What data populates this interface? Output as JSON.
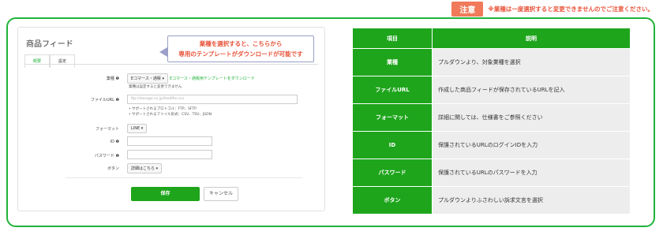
{
  "notice": {
    "badge": "注意",
    "text": "※業種は一度選択すると変更できませんのでご注意ください。"
  },
  "form": {
    "title": "商品フィード",
    "tabs": [
      {
        "label": "概要",
        "active": false
      },
      {
        "label": "設定",
        "active": true
      }
    ],
    "industry": {
      "label": "業種 ❶",
      "select_value": "Eコマース・通販 ▾",
      "template_link": "Eコマース・通販用テンプレートをダウンロード",
      "hint": "業種は設定すると変更できません"
    },
    "file_url": {
      "label": "ファイルURL ❶",
      "placeholder": "ftp://storage.co.jp/feedfile.csv",
      "bullets": [
        "サポートされるプロトコル：FTP、SFTP",
        "サポートされるファイル形式：CSV、TSV、JSON"
      ]
    },
    "format": {
      "label": "フォーマット",
      "select_value": "LINE ▾"
    },
    "id": {
      "label": "ID ❶"
    },
    "password": {
      "label": "パスワード ❶"
    },
    "button": {
      "label": "ボタン",
      "select_value": "詳細はこちら ▾"
    },
    "save_label": "保存",
    "cancel_label": "キャンセル"
  },
  "callout": {
    "line1": "業種を選択すると、こちらから",
    "line2": "専用のテンプレートがダウンロードが可能です"
  },
  "table": {
    "headers": [
      "項目",
      "説明"
    ],
    "rows": [
      {
        "key": "業種",
        "desc": "プルダウンより、対象業種を選択"
      },
      {
        "key": "ファイルURL",
        "desc": "作成した商品フィードが保存されているURLを記入"
      },
      {
        "key": "フォーマット",
        "desc": "詳細に関しては、仕様書をご参照ください"
      },
      {
        "key": "ID",
        "desc": "保護されているURLのログインIDを入力"
      },
      {
        "key": "パスワード",
        "desc": "保護されているURLのパスワードを入力"
      },
      {
        "key": "ボタン",
        "desc": "プルダウンよりふさわしい訴求文言を選択"
      }
    ]
  },
  "colors": {
    "accent_green": "#1ea51c",
    "frame_green": "#1fb33a",
    "notice_orange": "#f07a5a",
    "callout_red": "#e8543a"
  }
}
